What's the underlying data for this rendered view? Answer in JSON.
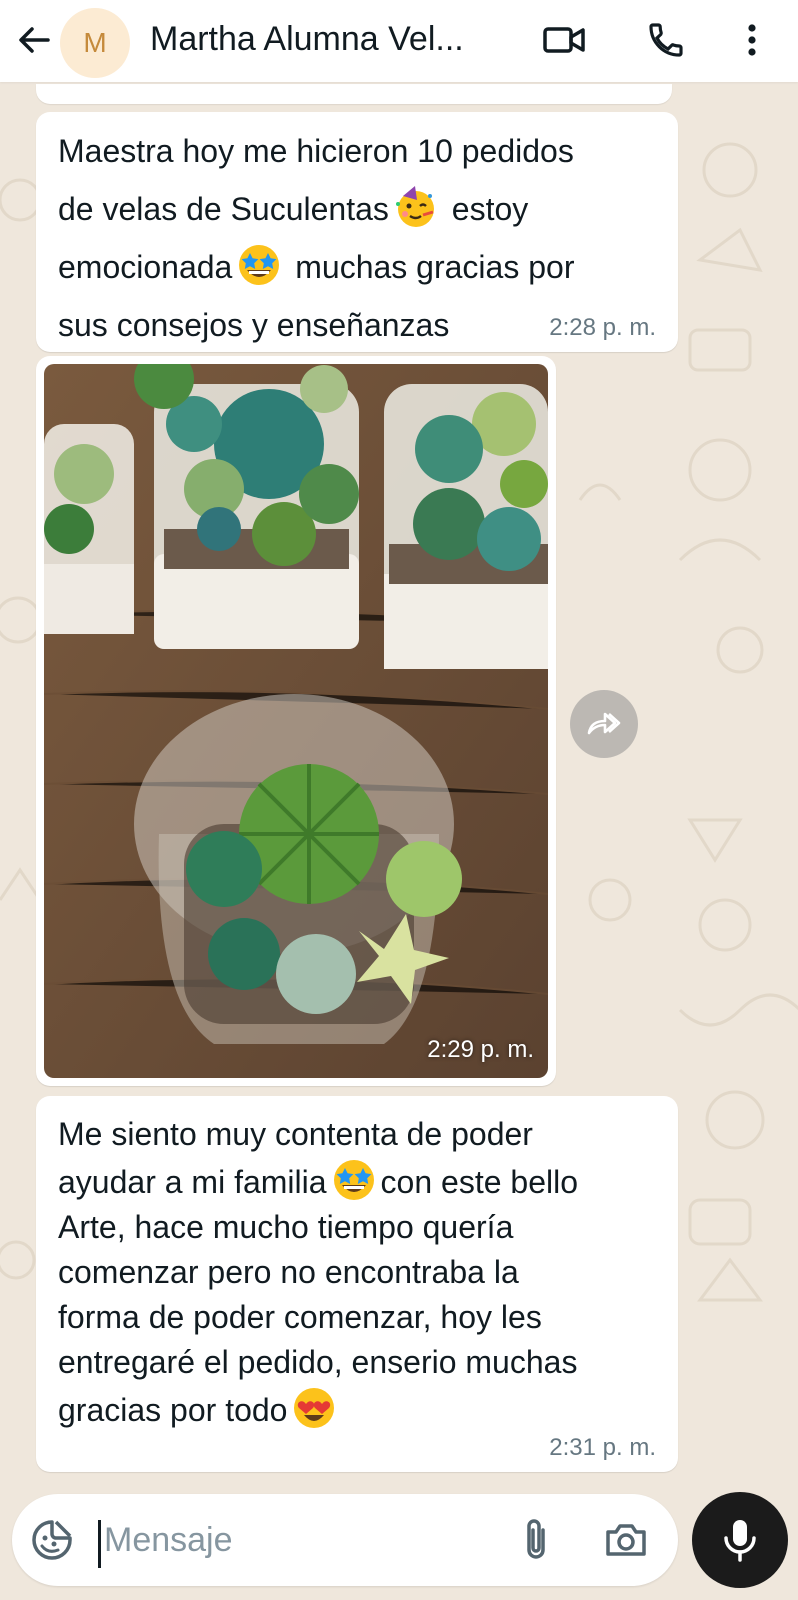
{
  "header": {
    "avatar_letter": "M",
    "contact_name": "Martha Alumna Vel...",
    "icons": [
      "back-arrow-icon",
      "video-call-icon",
      "phone-icon",
      "more-vert-icon"
    ]
  },
  "messages": [
    {
      "segments": [
        "Maestra hoy me hicieron 10 pedidos\nde velas de Suculentas",
        " estoy\nemocionada",
        " muchas gracias por\nsus consejos y enseñanzas"
      ],
      "emojis": [
        "partying-face-emoji",
        "star-struck-emoji"
      ],
      "time": "2:28 p. m."
    },
    {
      "type": "image",
      "image_description_icon": "succulent-candles-photo",
      "time": "2:29 p. m."
    },
    {
      "segments": [
        "Me siento muy contenta de poder\nayudar a mi familia",
        "con este bello\nArte, hace mucho tiempo quería\ncomenzar pero no encontraba la\nforma de poder comenzar, hoy les\nentregaré el pedido, enserio muchas\ngracias por todo"
      ],
      "emojis": [
        "star-struck-emoji",
        "heart-eyes-emoji"
      ],
      "time": "2:31 p. m."
    }
  ],
  "composer": {
    "placeholder": "Mensaje",
    "icons": [
      "sticker-icon",
      "attach-icon",
      "camera-icon",
      "mic-icon"
    ]
  },
  "colors": {
    "wallpaper": "#efe7dc",
    "bubble": "#ffffff",
    "text": "#111b21",
    "time": "#667781",
    "mic_button": "#1b1b1b"
  }
}
